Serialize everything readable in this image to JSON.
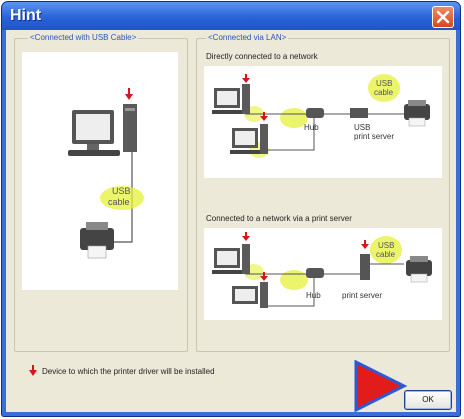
{
  "window": {
    "title": "Hint"
  },
  "usb_group": {
    "label": "<Connected with USB Cable>",
    "cable_label_line1": "USB",
    "cable_label_line2": "cable"
  },
  "lan_group": {
    "label": "<Connected via LAN>",
    "direct": {
      "caption": "Directly connected to a network",
      "usb_line1": "USB",
      "usb_line2": "cable",
      "hub": "Hub",
      "print_server_line1": "USB",
      "print_server_line2": "print server"
    },
    "via_server": {
      "caption": "Connected to a network via a print server",
      "usb_line1": "USB",
      "usb_line2": "cable",
      "hub": "Hub",
      "print_server": "print server"
    }
  },
  "legend": {
    "text": "Device to which the printer driver will be installed",
    "marker_color": "#d8141c"
  },
  "buttons": {
    "ok": "OK"
  },
  "colors": {
    "title_bar": "#2a63d6",
    "highlight": "#e6f03a",
    "arrow": "#d8141c"
  }
}
